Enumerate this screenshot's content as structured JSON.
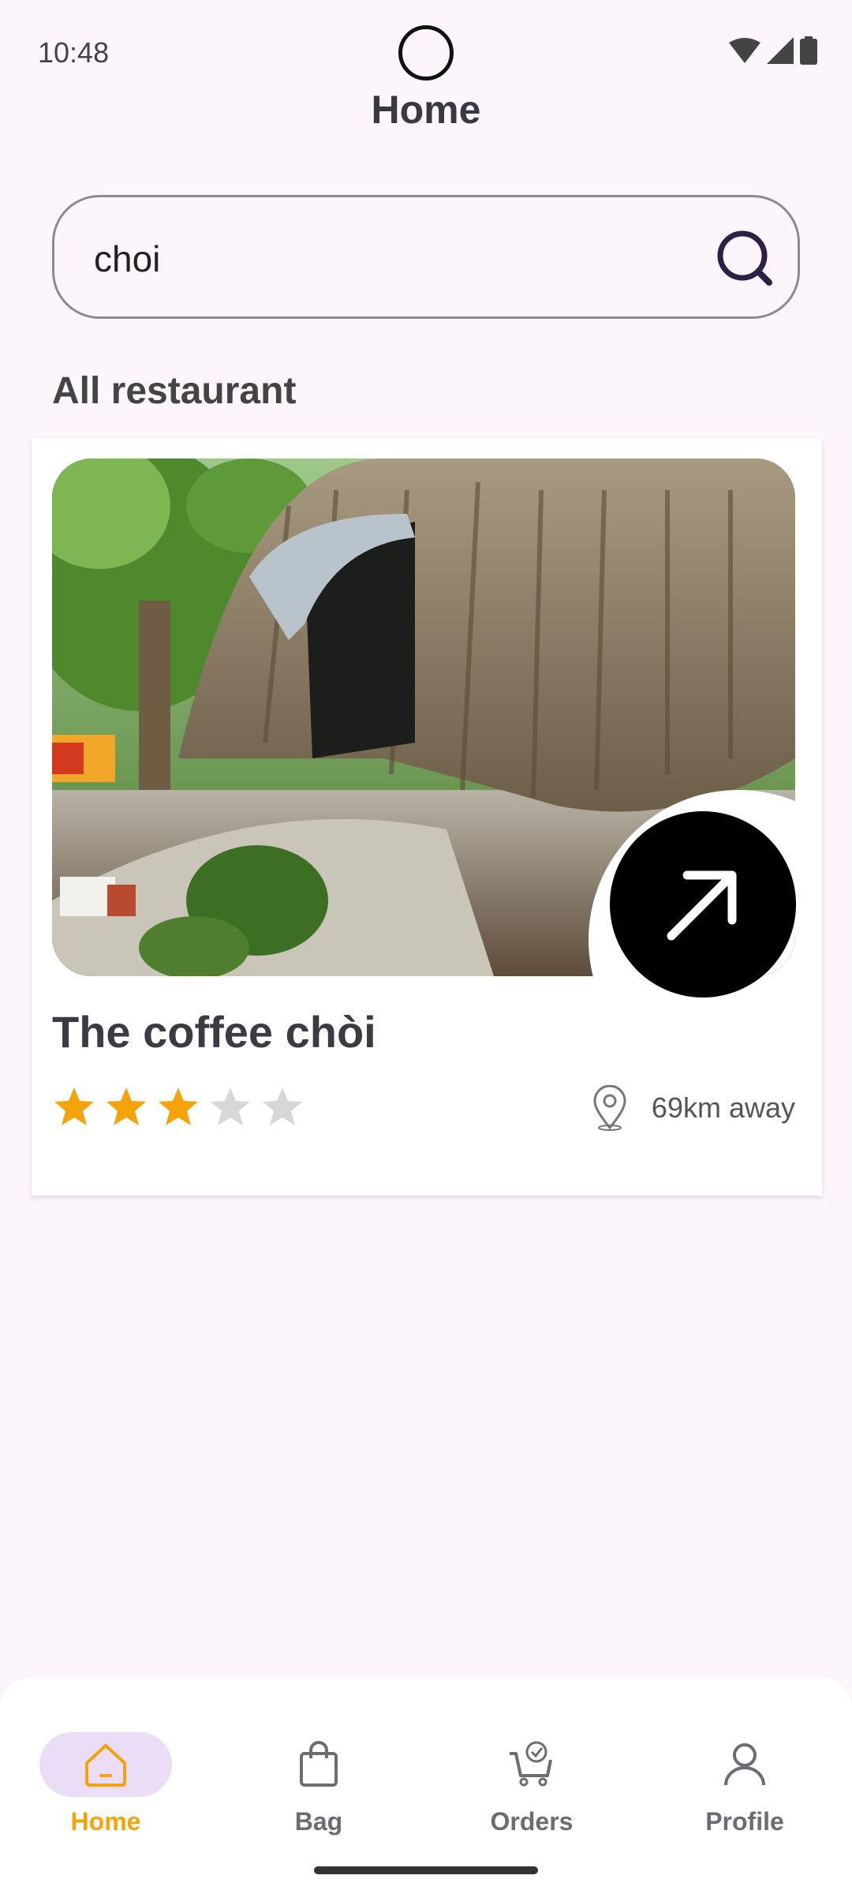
{
  "status_bar": {
    "time": "10:48"
  },
  "header": {
    "title": "Home"
  },
  "search": {
    "value": "choi",
    "placeholder": ""
  },
  "section": {
    "title": "All restaurant"
  },
  "restaurant": {
    "name": "The coffee chòi",
    "rating": 3,
    "max_rating": 5,
    "distance": "69km away"
  },
  "nav": {
    "items": [
      {
        "label": "Home",
        "icon": "home-icon",
        "active": true
      },
      {
        "label": "Bag",
        "icon": "bag-icon",
        "active": false
      },
      {
        "label": "Orders",
        "icon": "cart-check-icon",
        "active": false
      },
      {
        "label": "Profile",
        "icon": "person-icon",
        "active": false
      }
    ]
  },
  "colors": {
    "accent": "#F5A30B",
    "background": "#FCF5FC",
    "nav_active_pill": "#EADDF5",
    "star_filled": "#F5A30B",
    "star_empty": "#D7D7D7"
  }
}
